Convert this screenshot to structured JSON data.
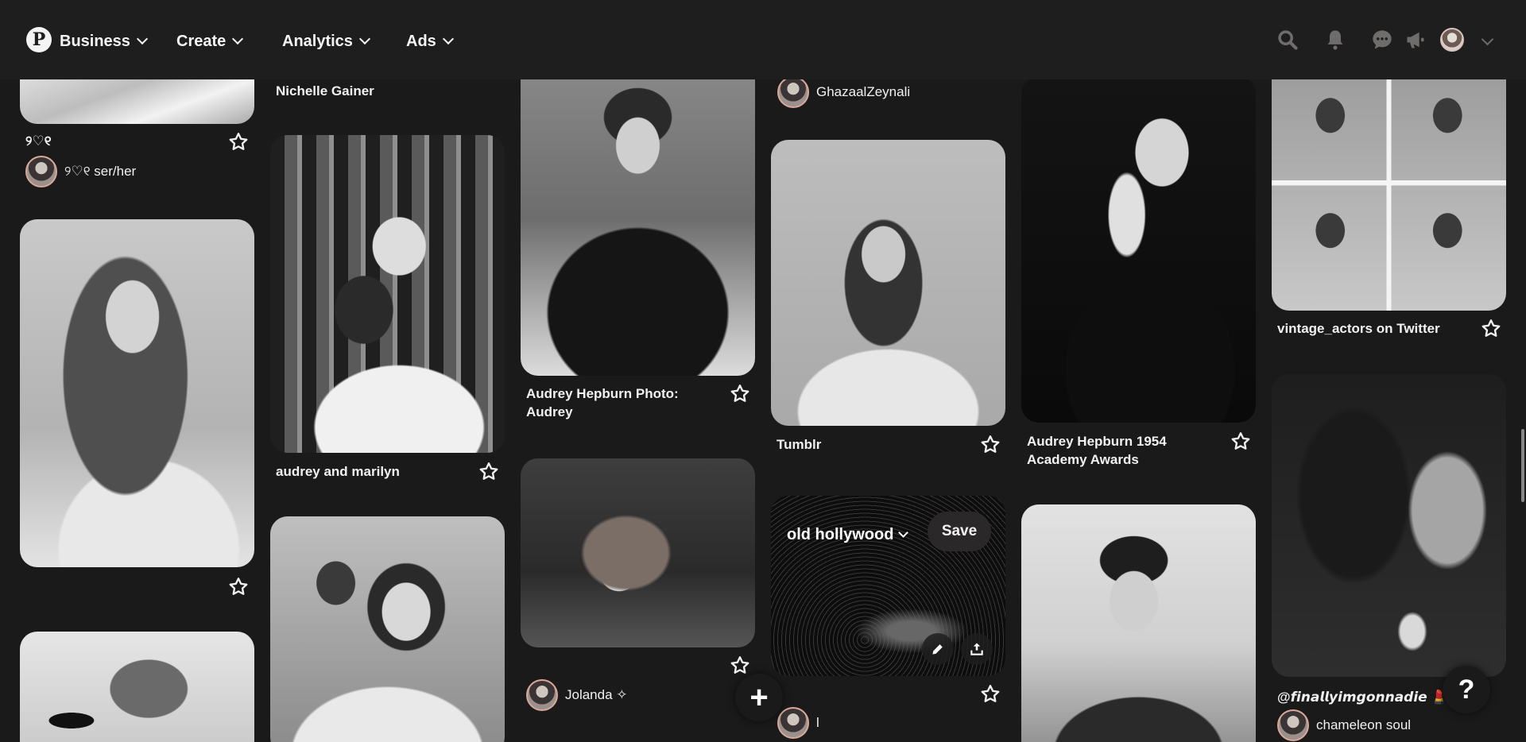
{
  "header": {
    "logo": "P",
    "nav": [
      {
        "label": "Business"
      },
      {
        "label": "Create"
      },
      {
        "label": "Analytics"
      },
      {
        "label": "Ads"
      }
    ],
    "icons": [
      "search-icon",
      "bell-icon",
      "chat-icon",
      "megaphone-icon"
    ]
  },
  "pins": {
    "c1p1": {
      "title": "୨♡୧",
      "creator": "୨♡୧ ser/her"
    },
    "c2p1": {
      "title": "Nichelle Gainer"
    },
    "c2p2": {
      "title": "audrey and marilyn"
    },
    "c3p1": {
      "title": "Audrey Hepburn Photo: Audrey"
    },
    "c3p2": {
      "creator": "Jolanda ✧"
    },
    "c4p1": {
      "creator": "GhazaalZeynali"
    },
    "c4p2": {
      "title": "Tumblr"
    },
    "c4p3": {
      "board": "old hollywood",
      "save": "Save",
      "creator": "l"
    },
    "c5p1": {
      "title": "Audrey Hepburn 1954 Academy Awards"
    },
    "c6p1": {
      "title": "vintage_actors on Twitter"
    },
    "c6p2": {
      "title": "@𝙛𝙞𝙣𝙖𝙡𝙡𝙮𝙞𝙢𝙜𝙤𝙣𝙣𝙖𝙙𝙞𝙚 💄🦢",
      "creator": "chameleon soul"
    }
  },
  "floating": {
    "add": "+",
    "help": "?"
  },
  "colors": {
    "background": "#1b1a1a",
    "header": "#1f1e1e",
    "text": "#f1f1f1"
  }
}
